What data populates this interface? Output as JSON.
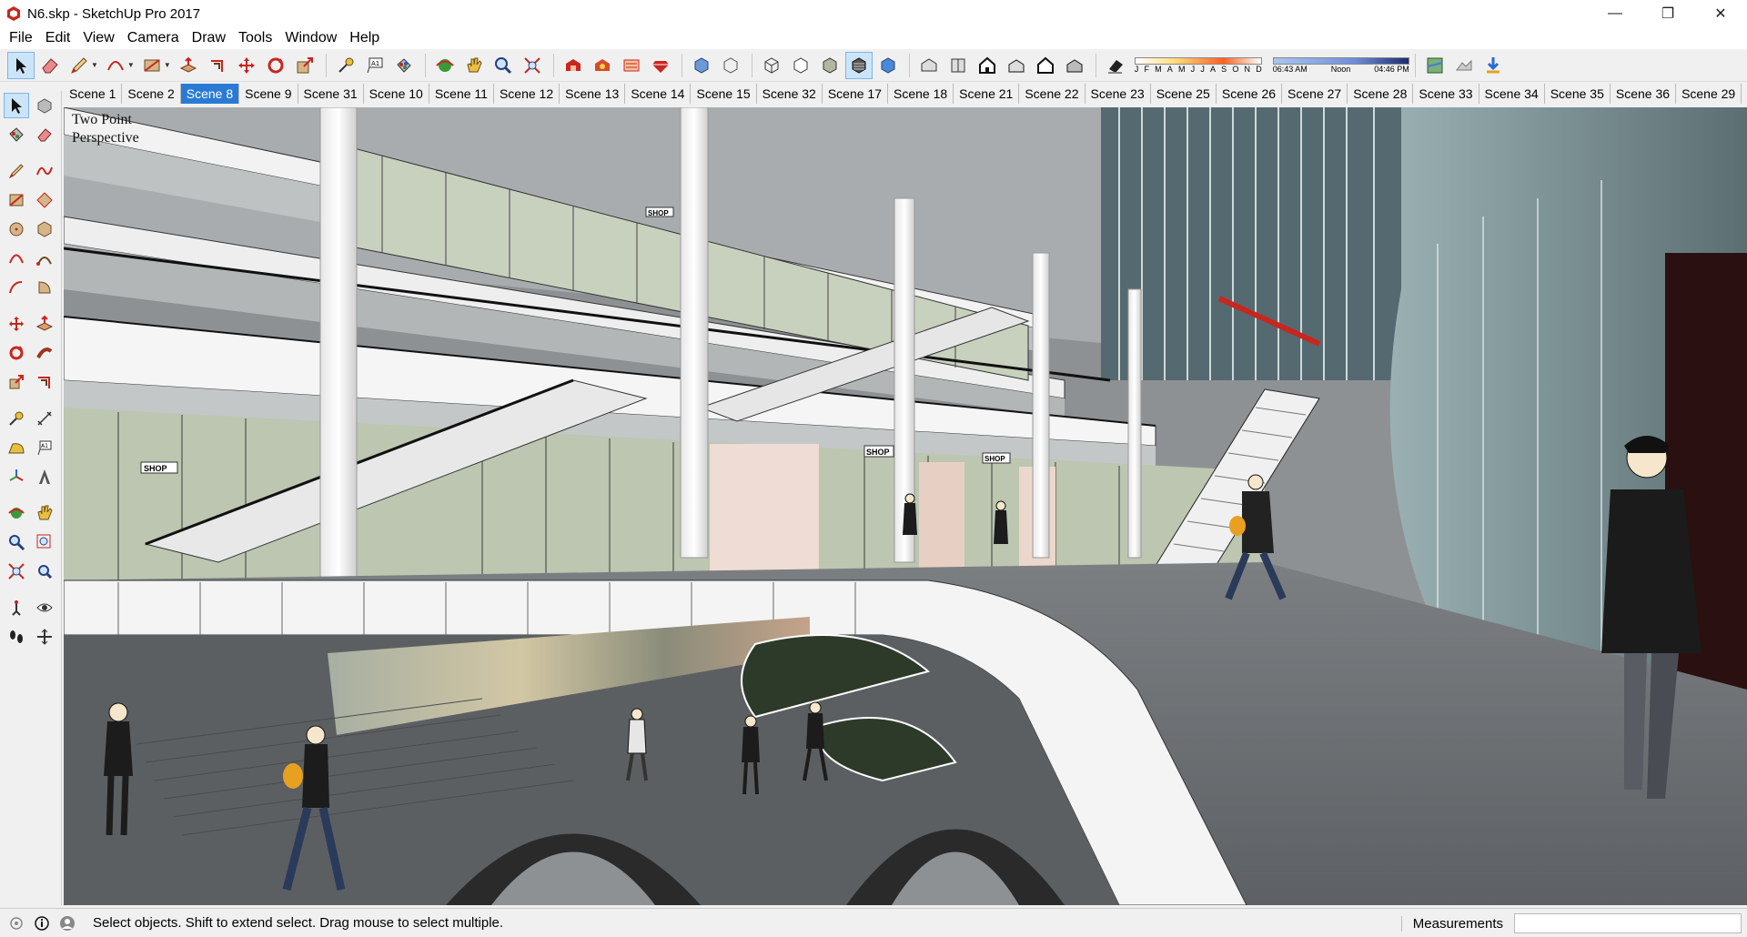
{
  "window": {
    "title": "N6.skp - SketchUp Pro 2017",
    "minimize": "—",
    "maximize": "❐",
    "close": "✕"
  },
  "menu": [
    "File",
    "Edit",
    "View",
    "Camera",
    "Draw",
    "Tools",
    "Window",
    "Help"
  ],
  "shadow": {
    "months": [
      "J",
      "F",
      "M",
      "A",
      "M",
      "J",
      "J",
      "A",
      "S",
      "O",
      "N",
      "D"
    ],
    "time_start": "06:43 AM",
    "time_mid": "Noon",
    "time_end": "04:46 PM"
  },
  "scenes": [
    "Scene 1",
    "Scene 2",
    "Scene 8",
    "Scene 9",
    "Scene 31",
    "Scene 10",
    "Scene 11",
    "Scene 12",
    "Scene 13",
    "Scene 14",
    "Scene 15",
    "Scene 32",
    "Scene 17",
    "Scene 18",
    "Scene 21",
    "Scene 22",
    "Scene 23",
    "Scene 25",
    "Scene 26",
    "Scene 27",
    "Scene 28",
    "Scene 33",
    "Scene 34",
    "Scene 35",
    "Scene 36",
    "Scene 29"
  ],
  "active_scene": "Scene 8",
  "viewport": {
    "label_line1": "Two Point",
    "label_line2": "Perspective",
    "shop_sign": "SHOP"
  },
  "status": {
    "message": "Select objects. Shift to extend select. Drag mouse to select multiple.",
    "measurements_label": "Measurements",
    "measurements_value": ""
  },
  "colors": {
    "accent": "#2a7ad5",
    "sketchup_red": "#c8261e"
  }
}
